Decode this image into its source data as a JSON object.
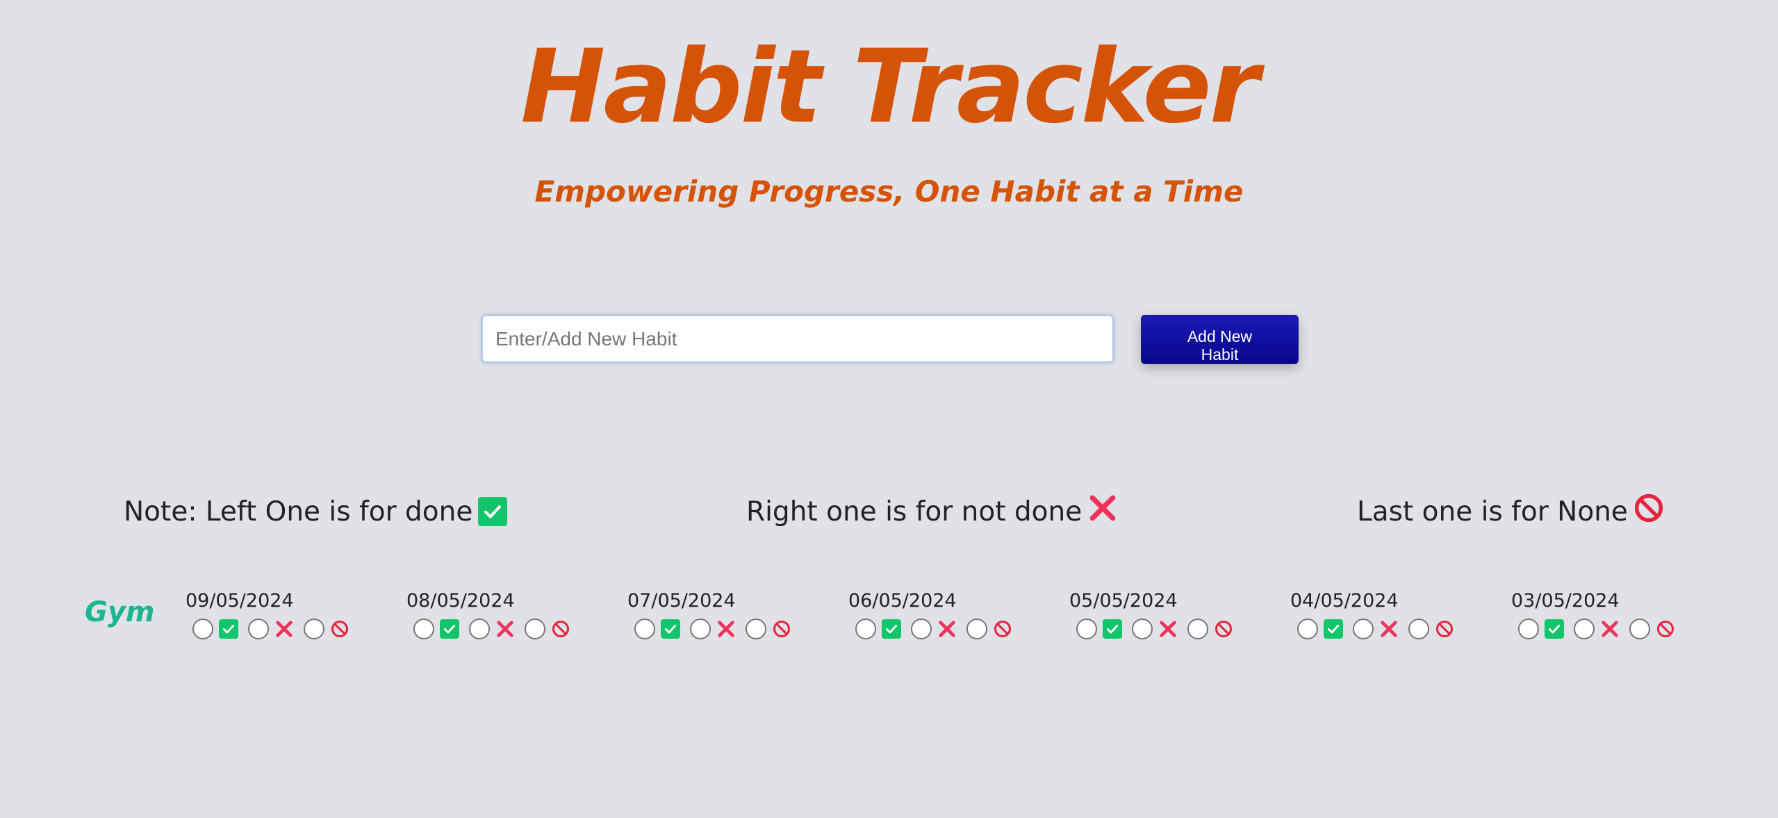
{
  "header": {
    "title": "Habit Tracker",
    "subtitle": "Empowering Progress, One Habit at a Time"
  },
  "form": {
    "input_placeholder": "Enter/Add New Habit",
    "input_value": "",
    "add_button_label": "Add New Habit"
  },
  "notes": [
    {
      "text": "Note: Left One is for done",
      "icon": "check-mark-icon"
    },
    {
      "text": "Right one is for not done",
      "icon": "cross-mark-icon"
    },
    {
      "text": "Last one is for None",
      "icon": "prohibited-icon"
    }
  ],
  "habits": [
    {
      "name": "Gym",
      "days": [
        {
          "date": "09/05/2024"
        },
        {
          "date": "08/05/2024"
        },
        {
          "date": "07/05/2024"
        },
        {
          "date": "06/05/2024"
        },
        {
          "date": "05/05/2024"
        },
        {
          "date": "04/05/2024"
        },
        {
          "date": "03/05/2024"
        }
      ]
    }
  ],
  "colors": {
    "background": "#e1e2e7",
    "title": "#d55307",
    "habit_name": "#1db591",
    "button": "#0f0fa3",
    "done": "#12c46a",
    "not_done": "#f0325a",
    "none": "#e5253f"
  }
}
